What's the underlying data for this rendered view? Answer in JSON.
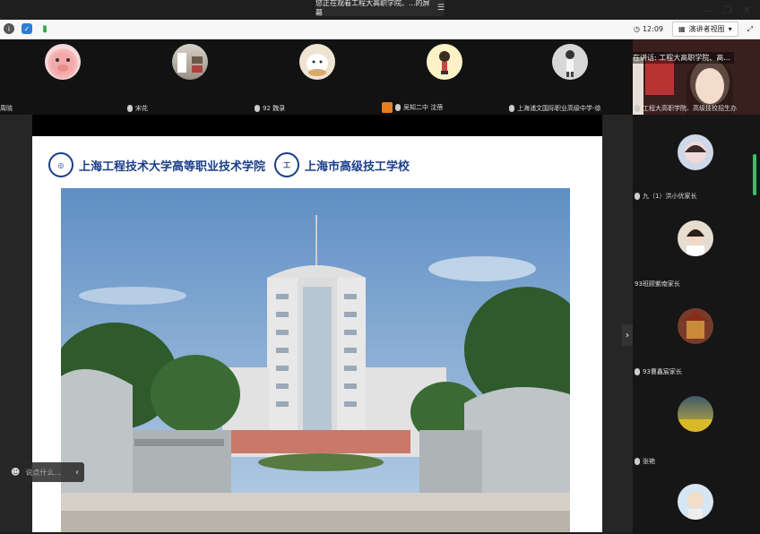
{
  "share_banner": {
    "text": "您正在观看工程大高职学院、...的屏幕",
    "menu_icon": "menu-icon"
  },
  "window_controls": {
    "minimize": "—",
    "restore": "❐",
    "close": "✕"
  },
  "toolbar": {
    "time": "12:09",
    "view_label": "演讲者视图",
    "view_arrow": "▾"
  },
  "participants_top": [
    {
      "name": "周晓",
      "avatar": "pig"
    },
    {
      "name": "宋花",
      "avatar": "room"
    },
    {
      "name": "92 魏录",
      "avatar": "toy"
    },
    {
      "name": "吴知二中 沈蓓",
      "avatar": "cartoon"
    },
    {
      "name": "上海浦文国际职业高级中学-徐",
      "avatar": "girl"
    }
  ],
  "speaker": {
    "tag": "正在讲话: 工程大高职学院、高...",
    "name": "工程大高职学院、高级技校招生办"
  },
  "slide": {
    "school1": "上海工程技术大学高等职业技术学院",
    "school2": "上海市高级技工学校"
  },
  "chat": {
    "placeholder": "说点什么...",
    "arrow": "‹"
  },
  "side_toggle": "›",
  "gallery": [
    {
      "name": "九（1）洪小优家长"
    },
    {
      "name": "93班顾紫南家长"
    },
    {
      "name": "93曹鑫宸家长"
    },
    {
      "name": "张艳"
    },
    {
      "name": ""
    }
  ],
  "colors": {
    "accent": "#1a3e8a",
    "speaking": "#3cbf6a"
  }
}
